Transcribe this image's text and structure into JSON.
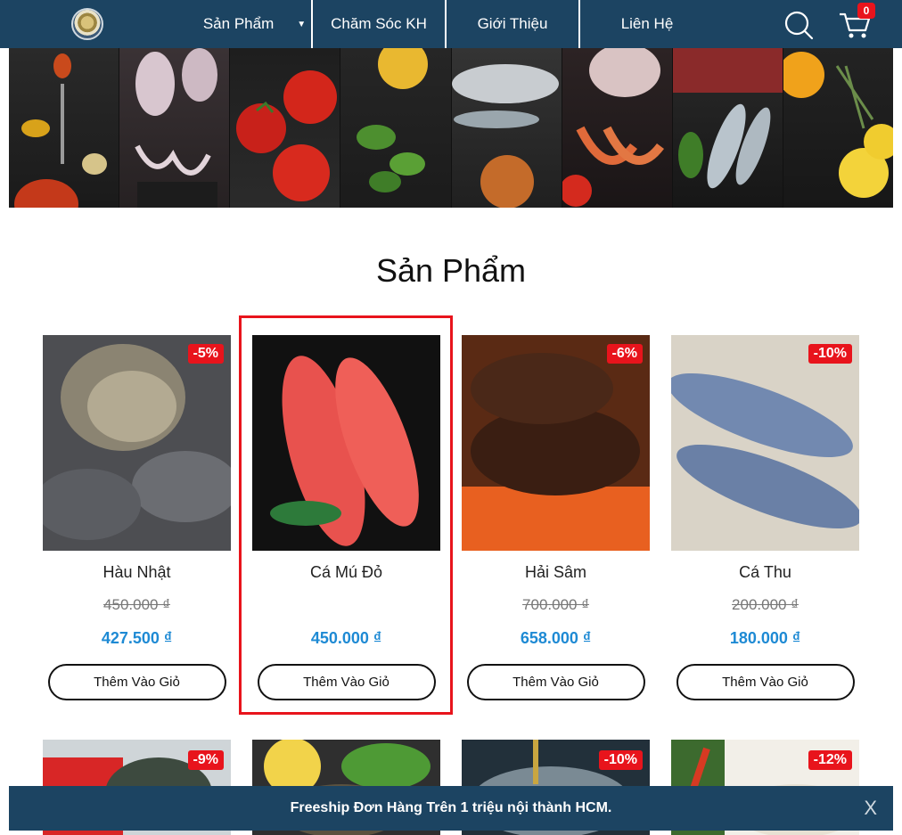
{
  "header": {
    "nav": [
      {
        "label": "Sản Phẩm"
      },
      {
        "label": "Chăm Sóc KH"
      },
      {
        "label": "Giới Thiệu"
      },
      {
        "label": "Liên Hệ"
      }
    ],
    "cart_count": "0"
  },
  "section_title": "Sản Phẩm",
  "products": [
    {
      "name": "Hàu Nhật",
      "discount": "-5%",
      "old_price": "450.000 ₫",
      "price": "427.500 ₫",
      "button": "Thêm Vào Giỏ"
    },
    {
      "name": "Cá Mú Đỏ",
      "discount": "",
      "old_price": "",
      "price": "450.000 ₫",
      "button": "Thêm Vào Giỏ"
    },
    {
      "name": "Hải Sâm",
      "discount": "-6%",
      "old_price": "700.000 ₫",
      "price": "658.000 ₫",
      "button": "Thêm Vào Giỏ"
    },
    {
      "name": "Cá Thu",
      "discount": "-10%",
      "old_price": "200.000 ₫",
      "price": "180.000 ₫",
      "button": "Thêm Vào Giỏ"
    }
  ],
  "products_row2": [
    {
      "discount": "-9%"
    },
    {
      "discount": ""
    },
    {
      "discount": "-10%"
    },
    {
      "discount": "-12%"
    }
  ],
  "notice": {
    "text": "Freeship Đơn Hàng Trên 1 triệu nội thành HCM.",
    "close": "X"
  },
  "colors": {
    "header_bg": "#1c4462",
    "badge": "#e8141c",
    "price": "#1e8ad4",
    "highlight": "#e8141c"
  }
}
